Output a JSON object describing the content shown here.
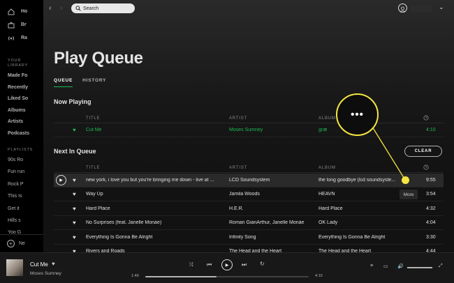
{
  "sidebar": {
    "nav": [
      {
        "label": "Ho",
        "icon": "home-icon"
      },
      {
        "label": "Br",
        "icon": "browse-icon"
      },
      {
        "label": "Ra",
        "icon": "radio-icon"
      }
    ],
    "library_heading": "YOUR LIBRARY",
    "library": [
      "Made Fo",
      "Recently",
      "Liked So",
      "Albums",
      "Artists",
      "Podcasts"
    ],
    "playlists_heading": "PLAYLISTS",
    "playlists": [
      "90s Ro",
      "Fun run",
      "Rock P",
      "This Is",
      "Get it ",
      "Hills s",
      "Yoo G"
    ],
    "new_playlist": "Ne"
  },
  "topbar": {
    "search_placeholder": "Search"
  },
  "page": {
    "title": "Play Queue",
    "tabs": [
      "QUEUE",
      "HISTORY"
    ],
    "now_playing_heading": "Now Playing",
    "next_heading": "Next In Queue",
    "clear_label": "CLEAR",
    "columns": {
      "title": "TITLE",
      "artist": "ARTIST",
      "album": "ALBUM"
    },
    "now_playing": {
      "title": "Cut Me",
      "artist": "Moses Sumney",
      "album": "græ",
      "duration": "4:10"
    },
    "queue": [
      {
        "title": "new york, i love you but you're bringing me down - live at ...",
        "artist": "LCD Soundsystem",
        "album": "the long goodbye (lcd soundsyste...",
        "duration": "9:55"
      },
      {
        "title": "Way Up",
        "artist": "Jamila Woods",
        "album": "HEAVN",
        "duration": "3:54"
      },
      {
        "title": "Hard Place",
        "artist": "H.E.R.",
        "album": "Hard Place",
        "duration": "4:32"
      },
      {
        "title": "No Surprises (feat. Janelle Monáe)",
        "artist": "Roman GianArthur, Janelle Monáe",
        "album": "OK Lady",
        "duration": "4:04"
      },
      {
        "title": "Everything Is Gonna Be Alright",
        "artist": "Infinity Song",
        "album": "Everything Is Gonna Be Alright",
        "duration": "3:30"
      },
      {
        "title": "Rivers and Roads",
        "artist": "The Head and the Heart",
        "album": "The Head and the Heart",
        "duration": "4:44"
      }
    ]
  },
  "callout": {
    "label": "•••",
    "tooltip": "More"
  },
  "player": {
    "title": "Cut Me",
    "artist": "Moses Sumney",
    "elapsed": "1:49",
    "total": "4:10",
    "progress": 0.436,
    "accent_color": "#1db954",
    "highlight_color": "#f5e642"
  }
}
